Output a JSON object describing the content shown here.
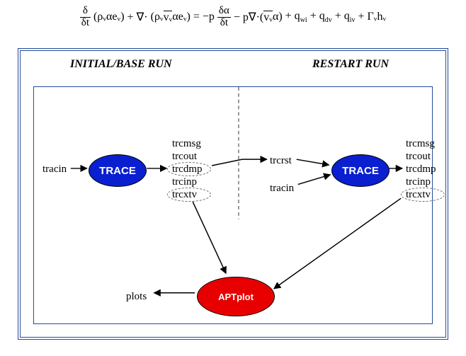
{
  "equation": {
    "lhs_frac_num": "δ",
    "lhs_frac_den": "δt",
    "lhs_paren1": "(ρᵥαeᵥ)",
    "nabla_dot": " + ∇·",
    "lhs_paren2_pre": "(ρᵥ",
    "lhs_paren2_over": "vᵥ",
    "lhs_paren2_post": "αeᵥ)",
    "eq": " = ",
    "rhs_mp": "−p",
    "rhs_frac_num": "δα",
    "rhs_frac_den": "δt",
    "rhs_mpnabla": " − p∇·(",
    "rhs_over": "vᵥ",
    "rhs_alpha_close": "α)",
    "tail": " + q",
    "sub_wi": "wi",
    "plus2": " + q",
    "sub_dv": "dv",
    "plus3": " + q",
    "sub_iv": "iv",
    "plus4": " + Γᵥhᵥ"
  },
  "headings": {
    "initial": "INITIAL/BASE RUN",
    "restart": "RESTART RUN"
  },
  "nodes": {
    "trace1": "TRACE",
    "trace2": "TRACE",
    "aptplot": "APTplot",
    "tracin1": "tracin",
    "tracin2": "tracin",
    "trcrst": "trcrst",
    "plots": "plots",
    "outputs1": [
      "trcmsg",
      "trcout",
      "trcdmp",
      "trcinp",
      "trcxtv"
    ],
    "outputs2": [
      "trcmsg",
      "trcout",
      "trcdmp",
      "trcinp",
      "trcxtv"
    ]
  },
  "chart_data": {
    "type": "diagram",
    "title": "TRACE / APTplot I/O flow — Initial vs Restart run",
    "left_panel": {
      "label": "INITIAL/BASE RUN",
      "process": "TRACE",
      "inputs": [
        "tracin"
      ],
      "outputs": [
        "trcmsg",
        "trcout",
        "trcdmp",
        "trcinp",
        "trcxtv"
      ],
      "feeds_restart": "trcdmp → trcrst",
      "feeds_aptplot": "trcxtv"
    },
    "right_panel": {
      "label": "RESTART RUN",
      "process": "TRACE",
      "inputs": [
        "trcrst",
        "tracin"
      ],
      "outputs": [
        "trcmsg",
        "trcout",
        "trcdmp",
        "trcinp",
        "trcxtv"
      ],
      "feeds_aptplot": "trcxtv"
    },
    "post_processor": {
      "process": "APTplot",
      "inputs": [
        "trcxtv (initial)",
        "trcxtv (restart)"
      ],
      "outputs": [
        "plots"
      ]
    }
  }
}
